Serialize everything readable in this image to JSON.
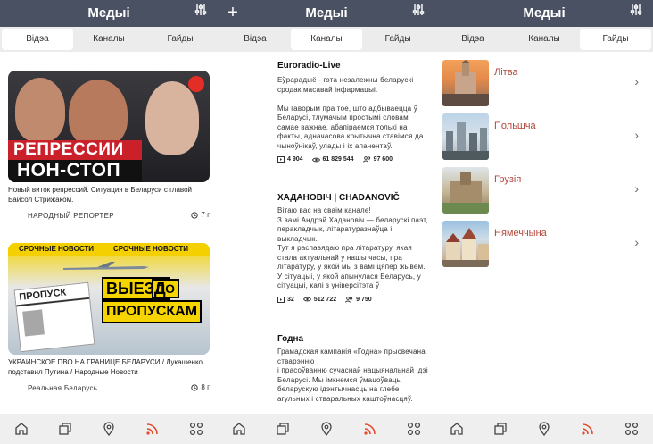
{
  "app": {
    "title": "Медыі",
    "tabs": [
      "Відэа",
      "Каналы",
      "Гайды"
    ],
    "accent": "#e24b2d",
    "header_color": "#4a5163"
  },
  "icons": {
    "settings": "sliders-icon",
    "add": "plus-icon",
    "bottom_nav": [
      "home-icon",
      "copy-icon",
      "location-pin-icon",
      "rss-icon",
      "grid-icon"
    ]
  },
  "videos": [
    {
      "title": "Новый виток репрессий. Ситуация в Беларуси с главой Байсол Стрижаком.",
      "channel": "НАРОДНЫЙ РЕПОРТЕР",
      "time": "7 г",
      "thumb_line1": "РЕПРЕССИИ",
      "thumb_line2": "НОН-СТОП"
    },
    {
      "title": "УКРАИНСКОЕ ПВО НА ГРАНИЦЕ БЕЛАРУСИ / Лукашенко подставил Путина / Народные Новости",
      "channel": "Реальная Беларусь",
      "time": "8 г",
      "thumb_strip_left": "СРОЧНЫЕ НОВОСТИ",
      "thumb_strip_right": "СРОЧНЫЕ НОВОСТИ",
      "thumb_big1": "ВЫЕЗД",
      "thumb_big2": "ПО",
      "thumb_big3": "ПРОПУСКАМ",
      "thumb_card": "ПРОПУСК"
    }
  ],
  "channels": [
    {
      "name": "Euroradio-Live",
      "description": "Еўрарадыё - гэта незалежны беларускі сродак масавай інфармацыі.\n\nМы гаворым пра тое, што адбываецца ў Беларусі, тлумачым простымі словамі самае важнае, абапіраемся толькі на факты, адначасова крытычна ставімся да чыноўнікаў, улады і іх апанентаў.",
      "videos": "4 904",
      "views": "61 829 544",
      "subscribers": "97 600"
    },
    {
      "name": "ХАДАНОВІЧ | CHADANOVIČ",
      "description": "Вітаю вас на сваім канале!\nЗ вамі Андрэй Хадановіч — беларускі паэт, перакладчык, літаратуразнаўца і выкладчык.\nТут я распавядаю пра літаратуру, якая стала актуальнай у нашы часы, пра літаратуру, у якой мы з вамі цяпер жывём.\nУ сітуацыі, у якой апынулася Беларусь, у сітуацыі, калі з універсітэта ў",
      "videos": "32",
      "views": "512 722",
      "subscribers": "9 750"
    },
    {
      "name": "Годна",
      "description": "Грамадская кампанія «Годна» прысвечана стварэнню\nі прасоўванню сучаснай нацыянальнай ідэі Беларусі. Мы імкнемся ўмацоўваць беларускую ідэнтычнасць на глебе агульных і стваральных каштоўнасцяў.",
      "videos": "",
      "views": "",
      "subscribers": ""
    }
  ],
  "guides": [
    {
      "label": "Літва",
      "image": "vilnius-church"
    },
    {
      "label": "Польшча",
      "image": "warsaw-skyline"
    },
    {
      "label": "Грузія",
      "image": "georgia-fortress"
    },
    {
      "label": "Нямеччына",
      "image": "german-town"
    }
  ]
}
